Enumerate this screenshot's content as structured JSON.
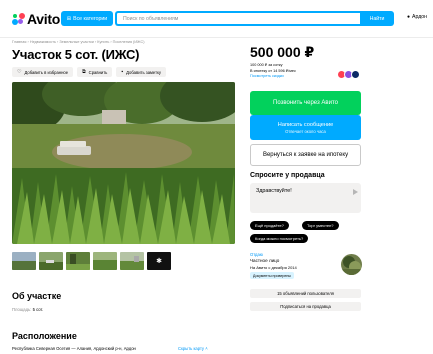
{
  "colors": {
    "brand_blue": "#00aaff",
    "call_green": "#02d15c",
    "link_blue": "#0099f7",
    "chip_bg": "#000000",
    "surface": "#f2f1f0"
  },
  "header": {
    "logo": "Avito",
    "categories_label": "Все категории",
    "categories_icon": "grid-icon",
    "search_placeholder": "Поиск по объявлениям",
    "search_button": "Найти",
    "location": "Ардон",
    "location_icon": "pin-icon"
  },
  "listing": {
    "breadcrumb": "Главная › Недвижимость › Земельные участки › Купить › Поселения (ИЖС)",
    "title": "Участок 5 сот. (ИЖС)",
    "actions": [
      {
        "label": "Добавить в избранное",
        "icon": "heart-icon"
      },
      {
        "label": "Сравнить",
        "icon": "compare-icon"
      },
      {
        "label": "Добавить заметку",
        "icon": "note-icon"
      }
    ],
    "thumbs_more_icon": "more-photos-icon"
  },
  "about": {
    "heading": "Об участке",
    "area_label": "Площадь:",
    "area_value": "5 сот."
  },
  "location_section": {
    "heading": "Расположение",
    "address": "Республика Северная Осетия — Алания, Ардонский р-н, Ардон",
    "map_link": "Скрыть карту"
  },
  "price": {
    "value": "500 000 ₽",
    "per_unit": "100 000 ₽ за сотку",
    "mortgage": "В ипотеку от 14 596 ₽/мес",
    "mortgage_link": "Посмотреть скидки"
  },
  "contact": {
    "call_button": "Позвонить через Авито",
    "message_button": "Написать сообщение",
    "message_sub": "Отвечает около часа",
    "return_button": "Вернуться к заявке на ипотеку"
  },
  "ask": {
    "title": "Спросите у продавца",
    "message": "Здравствуйте!",
    "chips": [
      "Ещё продаёте?",
      "Торг уместен?",
      "Когда можно посмотреть?"
    ]
  },
  "seller": {
    "label": "Отдаю",
    "type": "Частное лицо",
    "since": "На Авито с декабря 2014",
    "verified": "Документы проверены",
    "listings_button": "15 объявлений пользователя",
    "subscribe_button": "Подписаться на продавца"
  }
}
